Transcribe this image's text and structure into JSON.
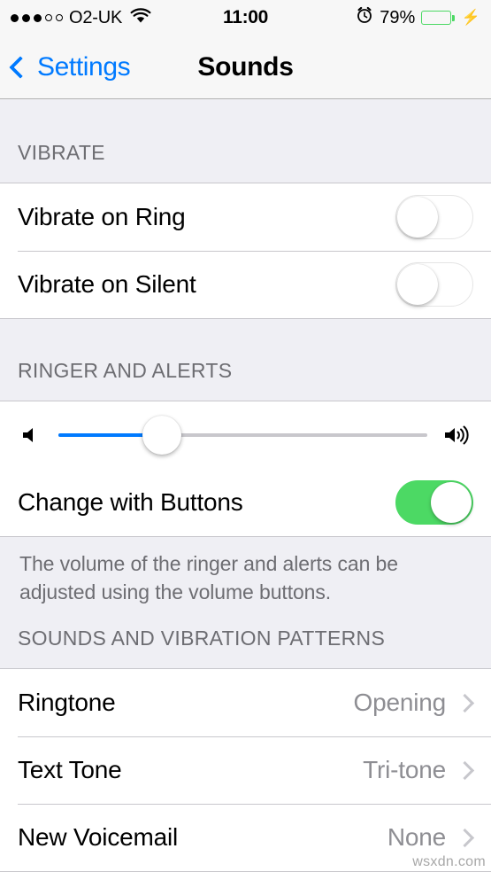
{
  "status_bar": {
    "signal_dots_filled": 3,
    "signal_dots_total": 5,
    "carrier": "O2-UK",
    "wifi_icon": "wifi-icon",
    "time": "11:00",
    "alarm_icon": "alarm-clock-icon",
    "battery_percent": "79%",
    "battery_level": 79,
    "charging_icon": "lightning-bolt-icon"
  },
  "nav": {
    "back_label": "Settings",
    "back_icon": "chevron-left-icon",
    "title": "Sounds"
  },
  "sections": [
    {
      "header": "VIBRATE",
      "rows": [
        {
          "label": "Vibrate on Ring",
          "control": "switch",
          "on": false
        },
        {
          "label": "Vibrate on Silent",
          "control": "switch",
          "on": false
        }
      ]
    },
    {
      "header": "RINGER AND ALERTS",
      "volume": {
        "low_icon": "speaker-low-icon",
        "high_icon": "speaker-high-icon",
        "value_percent": 28
      },
      "rows": [
        {
          "label": "Change with Buttons",
          "control": "switch",
          "on": true
        }
      ],
      "footer": "The volume of the ringer and alerts can be adjusted using the volume buttons."
    },
    {
      "header": "SOUNDS AND VIBRATION PATTERNS",
      "rows": [
        {
          "label": "Ringtone",
          "value": "Opening",
          "control": "disclosure"
        },
        {
          "label": "Text Tone",
          "value": "Tri-tone",
          "control": "disclosure"
        },
        {
          "label": "New Voicemail",
          "value": "None",
          "control": "disclosure"
        }
      ]
    }
  ],
  "watermark": "wsxdn.com",
  "colors": {
    "accent_blue": "#007aff",
    "switch_green": "#4cd964",
    "background": "#efeff4",
    "secondary_text": "#8e8e93",
    "header_text": "#6d6d72"
  }
}
